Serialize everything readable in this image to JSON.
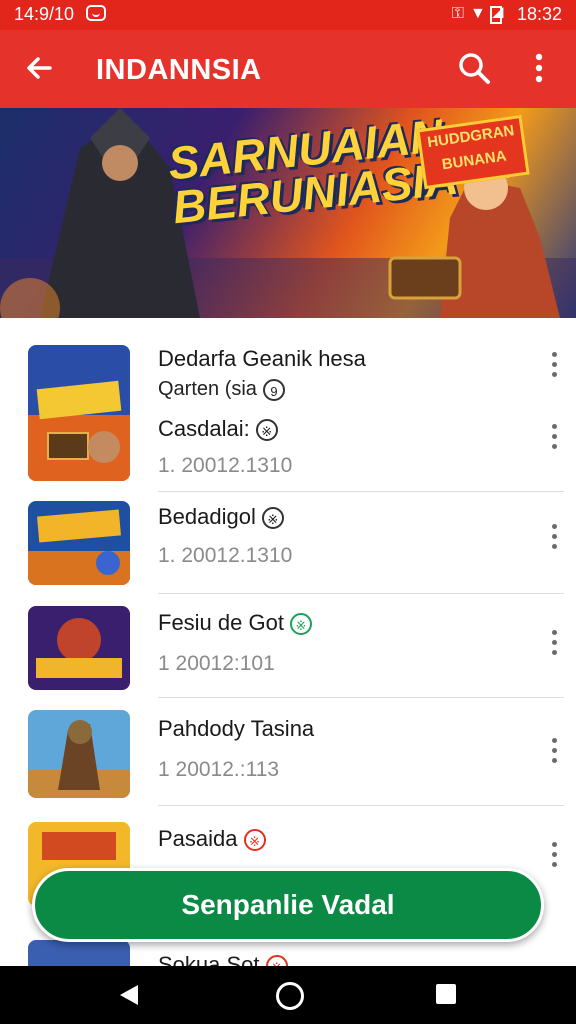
{
  "status_bar": {
    "time_left": "14:9/10",
    "time_right": "18:32"
  },
  "app_bar": {
    "title": "INDANNSIA"
  },
  "banner": {
    "title": "SARNUAIAN BERUNIASIA",
    "badge_text": "HUDDGRAN BUNANA"
  },
  "items": [
    {
      "name": "Dedarfa Geanik hesa",
      "subtitle": "Qarten (sia",
      "sub_badge": "9",
      "line3": "Casdalai:",
      "line3_badge": "※",
      "version": "1. 20012.1310"
    },
    {
      "name": "Bedadigol",
      "name_badge": "※",
      "version": "1. 20012.1310"
    },
    {
      "name": "Fesiu de Got",
      "name_badge": "※",
      "version": "1 20012:101"
    },
    {
      "name": "Pahdody Tasina",
      "version": "1 20012.:113"
    },
    {
      "name": "Pasaida",
      "name_badge": "※",
      "version": ""
    },
    {
      "name": "Sokua Sot",
      "name_badge": "※",
      "version": ""
    }
  ],
  "fab": {
    "label": "Senpanlie Vadal"
  },
  "colors": {
    "primary": "#e5322a",
    "fab": "#0b8a45",
    "nav": "#000000"
  }
}
